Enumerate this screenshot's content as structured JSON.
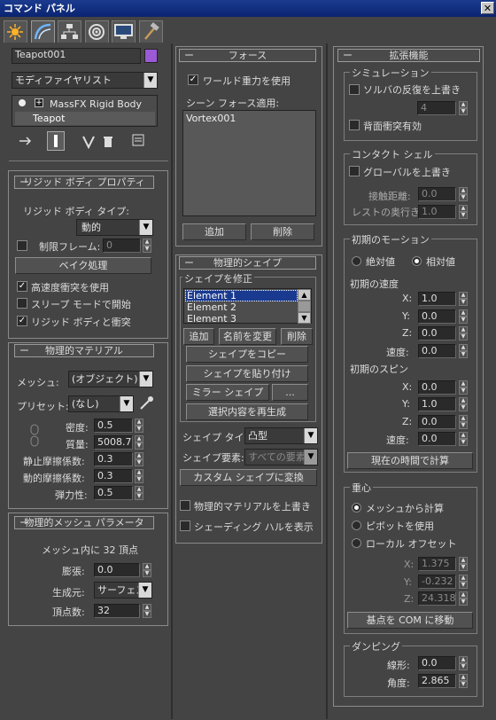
{
  "window": {
    "title": "コマンド パネル",
    "close": "✕"
  },
  "tabs": [
    "create",
    "modify",
    "hierarchy",
    "motion",
    "display",
    "utilities"
  ],
  "colors": {
    "swatch": "#9b59d6",
    "selection": "#1a3a8f"
  },
  "left": {
    "object_name": "Teapot001",
    "modifier_list": "モディファイヤリスト",
    "stack": {
      "item1": "MassFX Rigid Body",
      "item2": "Teapot"
    },
    "rigid_body_props": {
      "header": "リジッド ボディ プロパティ",
      "type_label": "リジッド ボディ タイプ:",
      "type_value": "動的",
      "limit_frames_label": "制限フレーム:",
      "limit_frames_value": "0",
      "bake_button": "ベイク処理",
      "high_speed": "高速度衝突を使用",
      "sleep_mode": "スリープ モードで開始",
      "collide": "リジッド ボディと衝突"
    },
    "material": {
      "header": "物理的マテリアル",
      "mesh_label": "メッシュ:",
      "mesh_value": "(オブジェクト)",
      "preset_label": "プリセット:",
      "preset_value": "(なし)",
      "density_label": "密度:",
      "density_value": "0.5",
      "mass_label": "質量:",
      "mass_value": "5008.75",
      "static_friction_label": "静止摩擦係数:",
      "static_friction_value": "0.3",
      "dynamic_friction_label": "動的摩擦係数:",
      "dynamic_friction_value": "0.3",
      "bounce_label": "弾力性:",
      "bounce_value": "0.5"
    },
    "mesh_params": {
      "header": "物理的メッシュ パラメータ",
      "vertices_info": "メッシュ内に 32 頂点",
      "inflation_label": "膨張:",
      "inflation_value": "0.0",
      "generate_label": "生成元:",
      "generate_value": "サーフェス",
      "vertex_count_label": "頂点数:",
      "vertex_count_value": "32"
    }
  },
  "middle": {
    "forces": {
      "header": "フォース",
      "world_gravity": "ワールド重力を使用",
      "scene_forces_label": "シーン フォース適用:",
      "list": [
        "Vortex001"
      ],
      "add": "追加",
      "remove": "削除"
    },
    "shapes": {
      "header": "物理的シェイプ",
      "modify_label": "シェイプを修正",
      "elements": [
        "Element 1",
        "Element 2",
        "Element 3"
      ],
      "add": "追加",
      "rename": "名前を変更",
      "delete": "削除",
      "copy": "シェイプをコピー",
      "paste": "シェイプを貼り付け",
      "mirror": "ミラー シェイプ",
      "more": "...",
      "regenerate": "選択内容を再生成",
      "type_label": "シェイプ タイプ:",
      "type_value": "凸型",
      "element_label": "シェイプ要素:",
      "element_value": "すべての要素",
      "convert": "カスタム シェイプに変換",
      "override_material": "物理的マテリアルを上書き",
      "display_hull": "シェーディング ハルを表示"
    }
  },
  "right": {
    "advanced": {
      "header": "拡張機能",
      "simulation_label": "シミュレーション",
      "override_solver": "ソルバの反復を上書き",
      "solver_value": "4",
      "backface": "背面衝突有効",
      "contact_shell_label": "コンタクト シェル",
      "override_global": "グローバルを上書き",
      "contact_distance_label": "接触距離:",
      "contact_distance_value": "0.0",
      "rest_depth_label": "レストの奥行き:",
      "rest_depth_value": "1.0",
      "initial_motion_label": "初期のモーション",
      "absolute": "絶対値",
      "relative": "相対値",
      "initial_velocity_label": "初期の速度",
      "vx": "1.0",
      "vy": "0.0",
      "vz": "0.0",
      "speed_label": "速度:",
      "speed_value": "0.0",
      "initial_spin_label": "初期のスピン",
      "sx": "0.0",
      "sy": "1.0",
      "sz": "0.0",
      "spin_speed_value": "0.0",
      "x_label": "X:",
      "y_label": "Y:",
      "z_label": "Z:",
      "compute_now": "現在の時間で計算",
      "center_mass_label": "重心",
      "from_mesh": "メッシュから計算",
      "use_pivot": "ピボットを使用",
      "local_offset": "ローカル オフセット",
      "ox": "1.375",
      "oy": "-0.232",
      "oz": "24.318",
      "move_pivot": "基点を COM に移動",
      "damping_label": "ダンピング",
      "linear_label": "線形:",
      "linear_value": "0.0",
      "angular_label": "角度:",
      "angular_value": "2.865"
    }
  }
}
